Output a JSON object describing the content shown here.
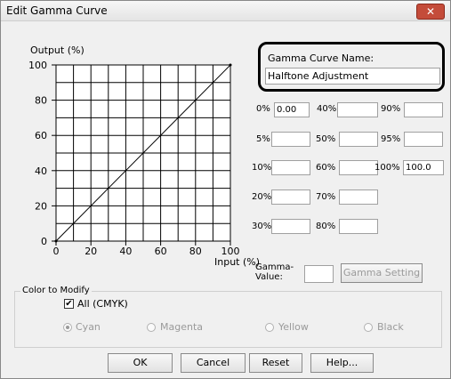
{
  "window": {
    "title": "Edit Gamma Curve",
    "close_glyph": "✕"
  },
  "chart": {
    "ylabel": "Output (%)",
    "xlabel": "Input (%)",
    "x_ticks": [
      "0",
      "20",
      "40",
      "60",
      "80",
      "100"
    ],
    "y_ticks": [
      "0",
      "20",
      "40",
      "60",
      "80",
      "100"
    ]
  },
  "chart_data": {
    "type": "line",
    "title": "",
    "xlabel": "Input (%)",
    "ylabel": "Output (%)",
    "xlim": [
      0,
      100
    ],
    "ylim": [
      0,
      100
    ],
    "grid": true,
    "x": [
      0,
      100
    ],
    "series": [
      {
        "values": [
          0,
          100
        ]
      }
    ]
  },
  "gamma_name": {
    "label": "Gamma Curve Name:",
    "value": "Halftone Adjustment"
  },
  "points": [
    {
      "label": "0%",
      "value": "0.00"
    },
    {
      "label": "40%",
      "value": ""
    },
    {
      "label": "90%",
      "value": ""
    },
    {
      "label": "5%",
      "value": ""
    },
    {
      "label": "50%",
      "value": ""
    },
    {
      "label": "95%",
      "value": ""
    },
    {
      "label": "10%",
      "value": ""
    },
    {
      "label": "60%",
      "value": ""
    },
    {
      "label": "100%",
      "value": "100.0"
    },
    {
      "label": "20%",
      "value": ""
    },
    {
      "label": "70%",
      "value": ""
    },
    {
      "label": "30%",
      "value": ""
    },
    {
      "label": "80%",
      "value": ""
    }
  ],
  "gamma_value": {
    "label_line1": "Gamma-",
    "label_line2": "Value:",
    "value": ""
  },
  "gamma_setting_label": "Gamma Setting",
  "color_group": {
    "label": "Color to Modify",
    "all_label": "All (CMYK)",
    "all_checked": true,
    "check_glyph": "✔",
    "options": [
      "Cyan",
      "Magenta",
      "Yellow",
      "Black"
    ]
  },
  "buttons": {
    "ok": "OK",
    "cancel": "Cancel",
    "reset": "Reset",
    "help": "Help..."
  },
  "icons": {
    "close": "close-icon",
    "check": "checkmark-icon"
  }
}
